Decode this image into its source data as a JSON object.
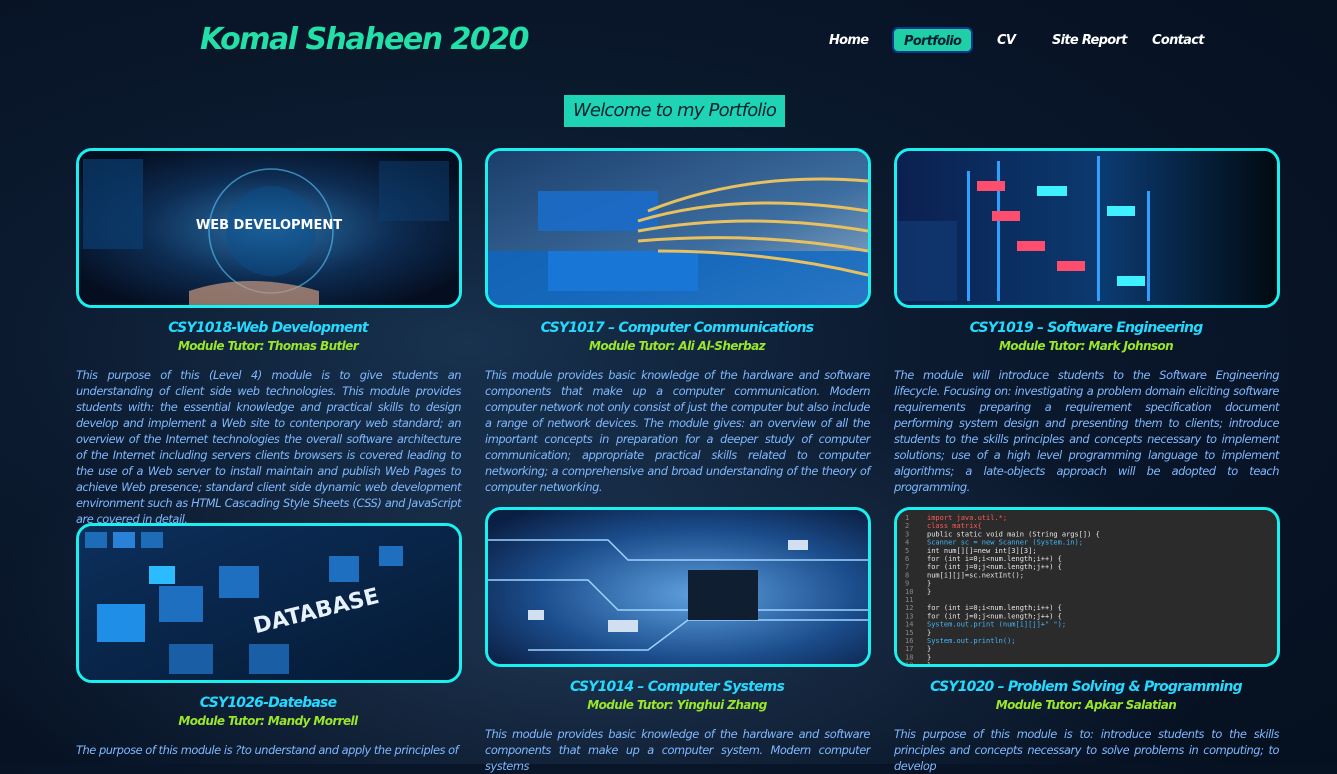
{
  "header": {
    "brand": "Komal Shaheen 2020"
  },
  "nav": {
    "items": [
      "Home",
      "Portfolio",
      "CV",
      "Site Report",
      "Contact"
    ],
    "active": "Portfolio"
  },
  "banner": {
    "text": "Welcome to my Portfolio"
  },
  "modules": [
    {
      "title": "CSY1018-Web Development",
      "tutor": "Module Tutor: Thomas Butler",
      "image_text": "WEB DEVELOPMENT",
      "description": "This purpose of this (Level 4) module is to give students an understanding of client side web technologies. This module provides students with: the essential knowledge and practical skills to design develop and implement a Web site to contenporary web standard; an overview of the Internet technologies the overall software architecture of the Internet including servers clients browsers is covered leading to the use of a Web server to install maintain and publish Web Pages to achieve Web presence; standard client side dynamic web development environment such as HTML Cascading Style Sheets (CSS) and JavaScript are covered in detail."
    },
    {
      "title": "CSY1017 – Computer Communications",
      "tutor": "Module Tutor: Ali Al-Sherbaz",
      "description": "This module provides basic knowledge of the hardware and software components that make up a computer communication. Modern computer network not only consist of just the computer but also include a range of network devices. The module gives: an overview of all the important concepts in preparation for a deeper study of computer communication; appropriate practical skills related to computer networking; a comprehensive and broad understanding of the theory of computer networking."
    },
    {
      "title": "CSY1019 – Software Engineering",
      "tutor": "Module Tutor: Mark Johnson",
      "description": "The module will introduce students to the Software Engineering lifecycle. Focusing on: investigating a problem domain eliciting software requirements preparing a requirement specification document performing system design and presenting them to clients; introduce students to the skills principles and concepts necessary to implement solutions; use of a high level programming language to implement algorithms; a late-objects approach will be adopted to teach programming."
    },
    {
      "title": "CSY1026-Datebase",
      "tutor": "Module Tutor: Mandy Morrell",
      "image_text": "DATABASE",
      "description": "The purpose of this module is ?to understand and apply the principles of"
    },
    {
      "title": "CSY1014 – Computer Systems",
      "tutor": "Module Tutor: Yinghui Zhang",
      "description": "This module provides basic knowledge of the hardware and software components that make up a computer system. Modern computer systems"
    },
    {
      "title": "CSY1020 – Problem Solving & Programming",
      "tutor": "Module Tutor: Apkar Salatian",
      "code_lines": [
        "import java.util.*;",
        "class matrix{",
        "    public static void main (String args[]) {",
        "        Scanner sc = new Scanner (System.in);",
        "        int num[][]=new int[3][3];",
        "        for (int i=0;i<num.length;i++) {",
        "            for (int j=0;j<num.length;j++) {",
        "                num[i][j]=sc.nextInt();",
        "            }",
        "        }",
        "",
        "        for (int i=0;i<num.length;i++) {",
        "            for (int j=0;j<num.length;j++) {",
        "                System.out.print (num[i][j]+\" \");",
        "            }",
        "            System.out.println();",
        "        }",
        "    }",
        "}"
      ],
      "description": "This purpose of this module is to: introduce students to the skills principles and concepts necessary to solve problems in computing; to develop"
    }
  ]
}
